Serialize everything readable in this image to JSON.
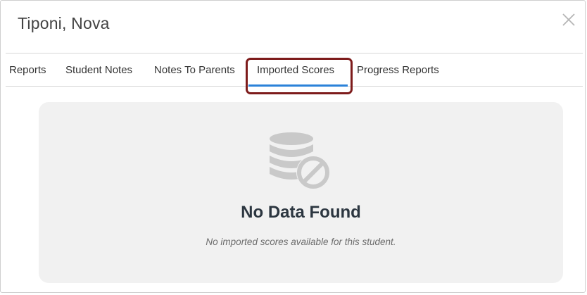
{
  "dialog": {
    "title": "Tiponi, Nova"
  },
  "tabs": [
    {
      "label": "Reports",
      "active": false
    },
    {
      "label": "Student Notes",
      "active": false
    },
    {
      "label": "Notes To Parents",
      "active": false
    },
    {
      "label": "Imported Scores",
      "active": true
    },
    {
      "label": "Progress Reports",
      "active": false
    }
  ],
  "empty_state": {
    "icon": "database-blocked-icon",
    "title": "No Data Found",
    "description": "No imported scores available for this student."
  },
  "colors": {
    "highlight_border": "#7d1b1b",
    "active_tab_underline": "#2b82d9",
    "panel_background": "#f1f1f1",
    "icon_gray": "#c9c9c9"
  }
}
